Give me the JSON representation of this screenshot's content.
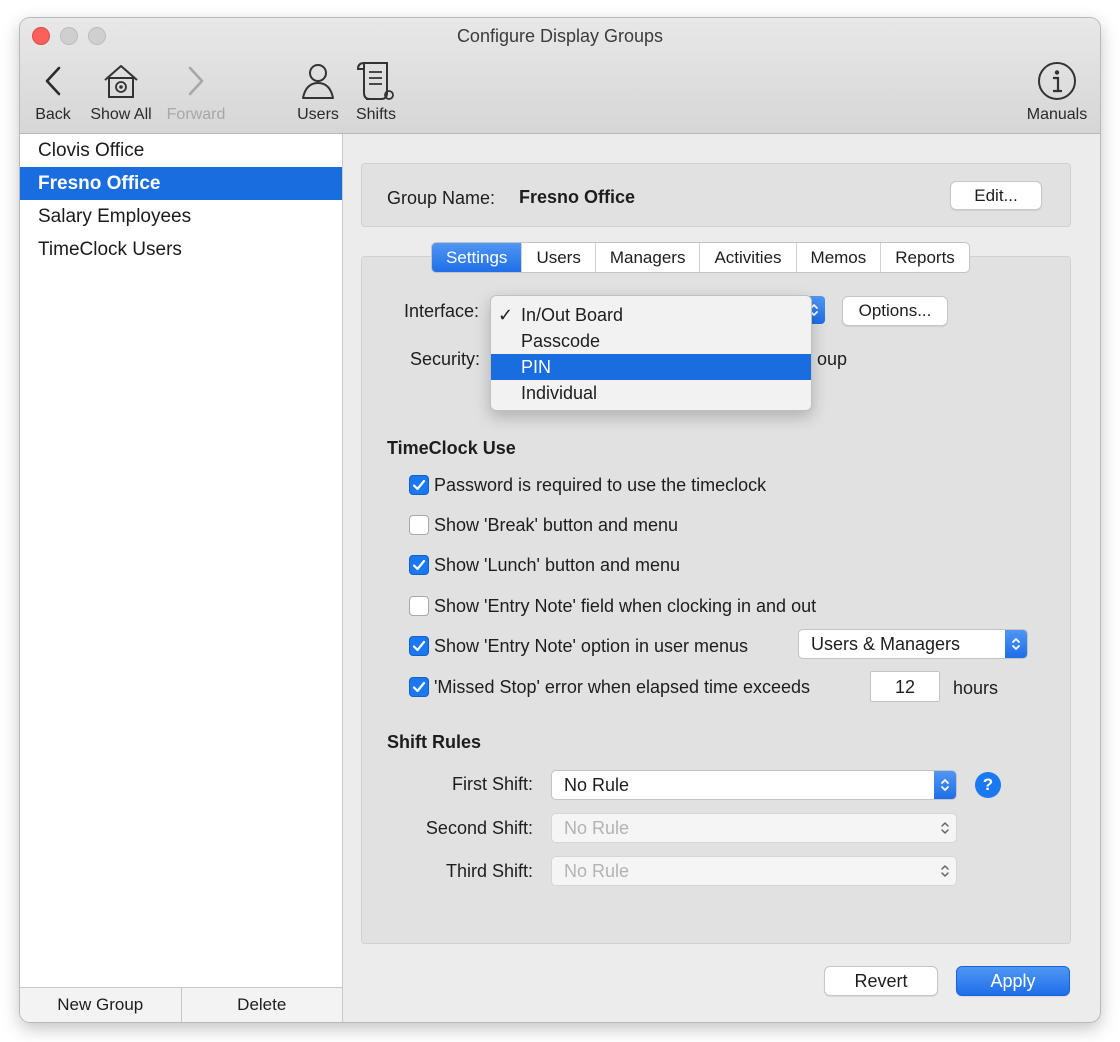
{
  "window": {
    "title": "Configure Display Groups"
  },
  "toolbar": {
    "back": "Back",
    "show_all": "Show All",
    "forward": "Forward",
    "users": "Users",
    "shifts": "Shifts",
    "manuals": "Manuals"
  },
  "sidebar": {
    "items": [
      {
        "label": "Clovis Office"
      },
      {
        "label": "Fresno Office"
      },
      {
        "label": "Salary Employees"
      },
      {
        "label": "TimeClock Users"
      }
    ],
    "new_group": "New Group",
    "delete": "Delete"
  },
  "group": {
    "name_label": "Group Name:",
    "name_value": "Fresno Office",
    "edit": "Edit..."
  },
  "tabs": [
    "Settings",
    "Users",
    "Managers",
    "Activities",
    "Memos",
    "Reports"
  ],
  "interface": {
    "label": "Interface:",
    "options_button": "Options..."
  },
  "security": {
    "label": "Security:",
    "trailing_text": "oup"
  },
  "dropdown": {
    "items": [
      {
        "label": "In/Out Board",
        "checked": "✓"
      },
      {
        "label": "Passcode"
      },
      {
        "label": "PIN"
      },
      {
        "label": "Individual"
      }
    ]
  },
  "timeclock": {
    "heading": "TimeClock Use",
    "options": [
      {
        "label": "Password is required to use the timeclock"
      },
      {
        "label": "Show 'Break' button and menu"
      },
      {
        "label": "Show 'Lunch' button and menu"
      },
      {
        "label": "Show 'Entry Note' field when clocking in and out"
      },
      {
        "label": "Show 'Entry Note' option in user menus"
      },
      {
        "label": "'Missed Stop' error when elapsed time exceeds"
      }
    ],
    "entry_note_select": "Users & Managers",
    "missed_stop_hours": "12",
    "hours_label": "hours"
  },
  "shifts": {
    "heading": "Shift Rules",
    "first_label": "First Shift:",
    "first_value": "No Rule",
    "second_label": "Second Shift:",
    "second_value": "No Rule",
    "third_label": "Third Shift:",
    "third_value": "No Rule",
    "help": "?"
  },
  "actions": {
    "revert": "Revert",
    "apply": "Apply"
  },
  "colors": {
    "accent": "#1a6ddf",
    "close": "#fc605c"
  }
}
